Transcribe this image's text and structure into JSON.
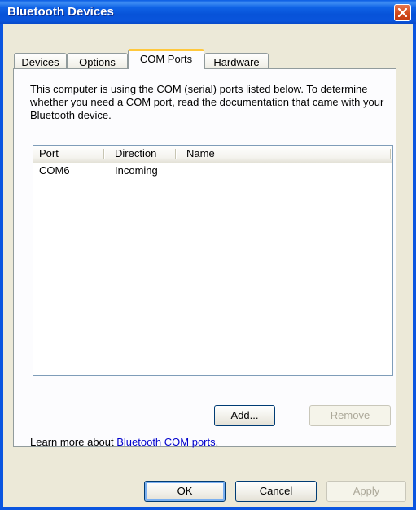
{
  "window": {
    "title": "Bluetooth Devices"
  },
  "tabs": [
    {
      "label": "Devices"
    },
    {
      "label": "Options"
    },
    {
      "label": "COM Ports"
    },
    {
      "label": "Hardware"
    }
  ],
  "panel": {
    "description": "This computer is using the COM (serial) ports listed below. To determine whether you need a COM port, read the documentation that came with your Bluetooth device.",
    "columns": [
      "Port",
      "Direction",
      "Name"
    ],
    "rows": [
      {
        "port": "COM6",
        "direction": "Incoming",
        "name": ""
      }
    ],
    "add_label": "Add...",
    "remove_label": "Remove",
    "learn_prefix": "Learn more about ",
    "learn_link": "Bluetooth COM ports",
    "learn_suffix": "."
  },
  "footer": {
    "ok_label": "OK",
    "cancel_label": "Cancel",
    "apply_label": "Apply"
  },
  "colors": {
    "titlebar": "#0a55e0",
    "client": "#ece9d8",
    "close": "#d24a1c",
    "tab_highlight": "#ffc83c",
    "link": "#0000cc"
  }
}
